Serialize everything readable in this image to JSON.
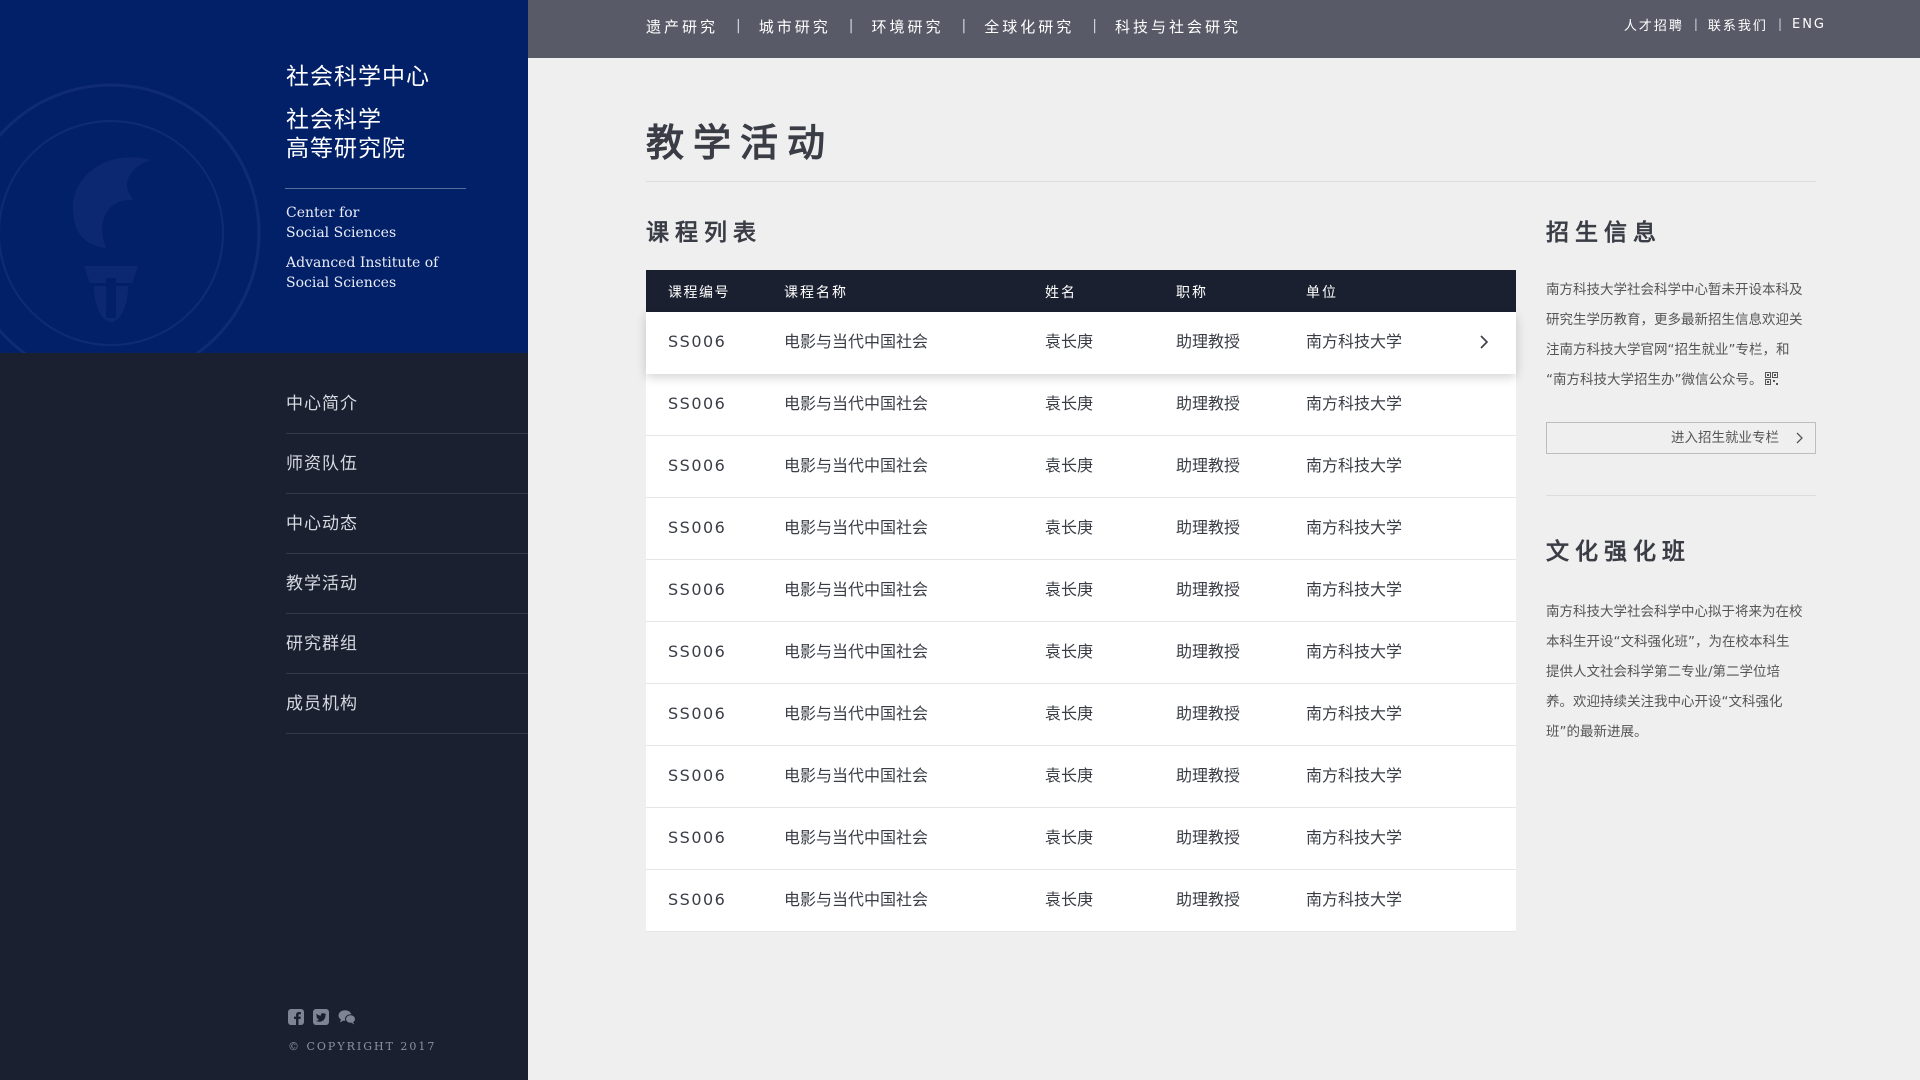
{
  "sidebar": {
    "brand": {
      "cn_title_1": "社会科学中心",
      "cn_title_2_line1": "社会科学",
      "cn_title_2_line2": "高等研究院",
      "en_1_line1": "Center for",
      "en_1_line2": "Social Sciences",
      "en_2_line1": "Advanced Institute of",
      "en_2_line2": "Social Sciences"
    },
    "nav": [
      {
        "label": "中心简介"
      },
      {
        "label": "师资队伍"
      },
      {
        "label": "中心动态"
      },
      {
        "label": "教学活动"
      },
      {
        "label": "研究群组"
      },
      {
        "label": "成员机构"
      }
    ],
    "social_icons": [
      "facebook-icon",
      "twitter-icon",
      "wechat-icon"
    ],
    "copyright": "© COPYRIGHT 2017"
  },
  "topnav": {
    "items": [
      {
        "label": "遗产研究"
      },
      {
        "label": "城市研究"
      },
      {
        "label": "环境研究"
      },
      {
        "label": "全球化研究"
      },
      {
        "label": "科技与社会研究"
      }
    ],
    "separator": "|",
    "links": [
      {
        "label": "人才招聘"
      },
      {
        "label": "联系我们"
      },
      {
        "label": "ENG"
      }
    ]
  },
  "main": {
    "page_title": "教学活动",
    "course_section_title": "课程列表",
    "table": {
      "headers": [
        "课程编号",
        "课程名称",
        "姓名",
        "职称",
        "单位"
      ],
      "rows": [
        [
          "SS006",
          "电影与当代中国社会",
          "袁长庚",
          "助理教授",
          "南方科技大学"
        ],
        [
          "SS006",
          "电影与当代中国社会",
          "袁长庚",
          "助理教授",
          "南方科技大学"
        ],
        [
          "SS006",
          "电影与当代中国社会",
          "袁长庚",
          "助理教授",
          "南方科技大学"
        ],
        [
          "SS006",
          "电影与当代中国社会",
          "袁长庚",
          "助理教授",
          "南方科技大学"
        ],
        [
          "SS006",
          "电影与当代中国社会",
          "袁长庚",
          "助理教授",
          "南方科技大学"
        ],
        [
          "SS006",
          "电影与当代中国社会",
          "袁长庚",
          "助理教授",
          "南方科技大学"
        ],
        [
          "SS006",
          "电影与当代中国社会",
          "袁长庚",
          "助理教授",
          "南方科技大学"
        ],
        [
          "SS006",
          "电影与当代中国社会",
          "袁长庚",
          "助理教授",
          "南方科技大学"
        ],
        [
          "SS006",
          "电影与当代中国社会",
          "袁长庚",
          "助理教授",
          "南方科技大学"
        ],
        [
          "SS006",
          "电影与当代中国社会",
          "袁长庚",
          "助理教授",
          "南方科技大学"
        ]
      ]
    }
  },
  "aside": {
    "admissions": {
      "title": "招生信息",
      "line1": "南方科技大学社会科学中心暂未开设本科及",
      "line2": "研究生学历教育，更多最新招生信息欢迎关",
      "line3": "注南方科技大学官网“招生就业”专栏，和",
      "line4": "“南方科技大学招生办”微信公众号。",
      "button_label": "进入招生就业专栏"
    },
    "culture": {
      "title": "文化强化班",
      "line1": "南方科技大学社会科学中心拟于将来为在校",
      "line2": "本科生开设“文科强化班”，为在校本科生",
      "line3": "提供人文社会科学第二专业/第二学位培",
      "line4": "养。欢迎持续关注我中心开设“文科强化",
      "line5": "班”的最新进展。"
    }
  }
}
